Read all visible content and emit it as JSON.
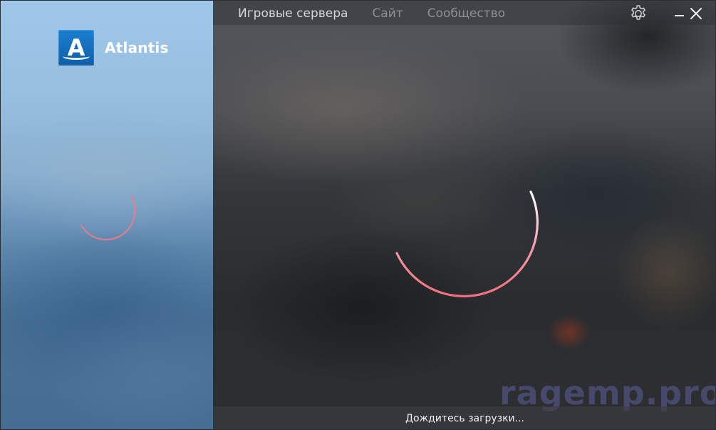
{
  "app": {
    "title": "Atlantis",
    "logo_letter": "A",
    "accent": "#1c7fd0"
  },
  "nav": {
    "items": [
      {
        "label": "Игровые сервера",
        "active": true
      },
      {
        "label": "Сайт",
        "active": false
      },
      {
        "label": "Сообщество",
        "active": false
      }
    ]
  },
  "window_controls": {
    "settings_icon": "gear-icon",
    "minimize_icon": "minimize-icon",
    "close_icon": "close-icon"
  },
  "status": {
    "text": "Дождитесь загрузки..."
  },
  "watermark": {
    "text": "ragemp.pro"
  },
  "colors": {
    "spinner": "#f07a8a",
    "sidebar": "#8fb8dc",
    "background": "#2c2e31"
  }
}
